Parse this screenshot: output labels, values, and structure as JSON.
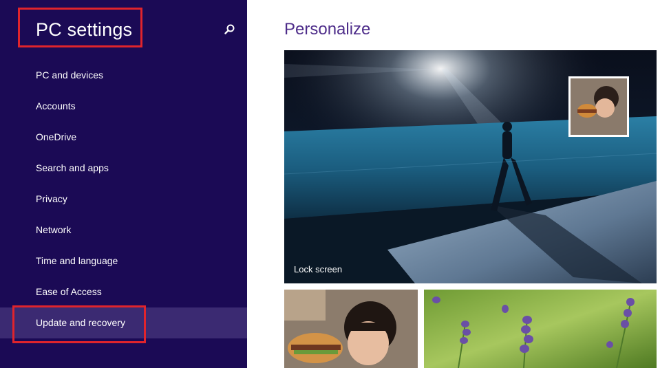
{
  "sidebar": {
    "title": "PC settings",
    "search_icon": "search-icon",
    "items": [
      {
        "label": "PC and devices"
      },
      {
        "label": "Accounts"
      },
      {
        "label": "OneDrive"
      },
      {
        "label": "Search and apps"
      },
      {
        "label": "Privacy"
      },
      {
        "label": "Network"
      },
      {
        "label": "Time and language"
      },
      {
        "label": "Ease of Access"
      },
      {
        "label": "Update and recovery",
        "selected": true
      }
    ]
  },
  "main": {
    "title": "Personalize",
    "lock_screen_label": "Lock screen"
  },
  "colors": {
    "sidebar_bg": "#1b0a55",
    "selected_item_bg": "#3b2a72",
    "accent_title": "#4e2d8a",
    "highlight_box": "#e0242c"
  }
}
